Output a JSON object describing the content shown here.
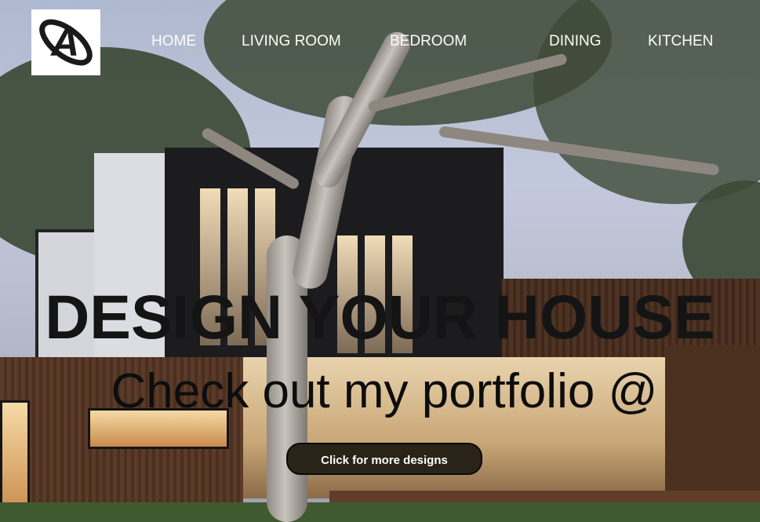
{
  "logo": {
    "letter": "A",
    "icon": "atom-a-logo-icon"
  },
  "nav": {
    "items": [
      {
        "label": "HOME"
      },
      {
        "label": "LIVING ROOM"
      },
      {
        "label": "BEDROOM"
      },
      {
        "label": "DINING"
      },
      {
        "label": "KITCHEN"
      }
    ]
  },
  "hero": {
    "title": "DESIGN YOUR HOUSE",
    "subtitle": "Check out my portfolio @",
    "cta_label": "Click for more designs"
  },
  "colors": {
    "nav_text": "#fffdf5",
    "title_text": "#141414",
    "cta_background": "#2a2418",
    "cta_text": "#ffffff"
  }
}
